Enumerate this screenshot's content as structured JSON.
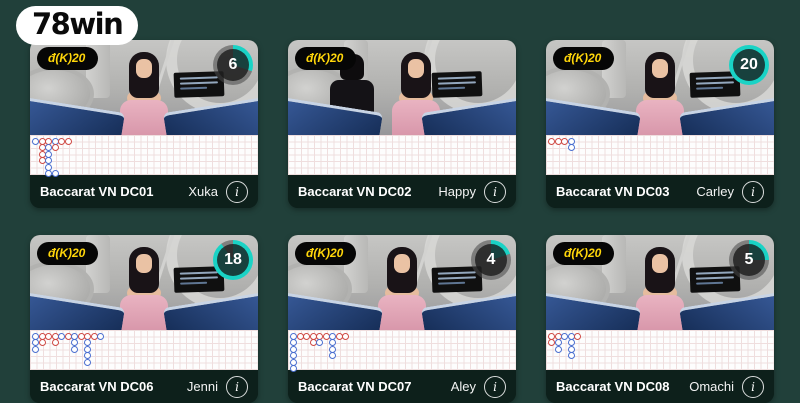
{
  "logo": {
    "text": "78win"
  },
  "icons": {
    "info": "i"
  },
  "colors": {
    "timer_arc": "#19d3c5",
    "timer_track": "rgba(72,72,72,0.55)",
    "road_red": "#cf4a45",
    "road_blue": "#4a6fd0",
    "badge_bg": "#060606",
    "badge_text": "#ffd60a",
    "page_bg": "#21403a"
  },
  "timer_max_seconds": 20,
  "cards": [
    {
      "title": "Baccarat VN DC01",
      "dealer": "Xuka",
      "min_bet": "đ(K)20",
      "has_timer": true,
      "timer": "6",
      "timer_pct": 30,
      "road": [
        [
          0,
          0,
          "B"
        ],
        [
          1,
          0,
          "R"
        ],
        [
          2,
          0,
          "R"
        ],
        [
          3,
          0,
          "B"
        ],
        [
          4,
          0,
          "R"
        ],
        [
          5,
          0,
          "R"
        ],
        [
          1,
          1,
          "R"
        ],
        [
          2,
          1,
          "B"
        ],
        [
          3,
          1,
          "R"
        ],
        [
          1,
          2,
          "R"
        ],
        [
          2,
          2,
          "B"
        ],
        [
          1,
          3,
          "R"
        ],
        [
          2,
          3,
          "B"
        ],
        [
          2,
          4,
          "B"
        ],
        [
          2,
          5,
          "B"
        ],
        [
          3,
          5,
          "B"
        ]
      ]
    },
    {
      "title": "Baccarat VN DC02",
      "dealer": "Happy",
      "min_bet": "đ(K)20",
      "has_timer": false,
      "timer": "",
      "timer_pct": 0,
      "road": []
    },
    {
      "title": "Baccarat VN DC03",
      "dealer": "Carley",
      "min_bet": "đ(K)20",
      "has_timer": true,
      "timer": "20",
      "timer_pct": 100,
      "road": [
        [
          0,
          0,
          "R"
        ],
        [
          1,
          0,
          "R"
        ],
        [
          2,
          0,
          "R"
        ],
        [
          3,
          0,
          "B"
        ],
        [
          3,
          1,
          "B"
        ]
      ]
    },
    {
      "title": "Baccarat VN DC06",
      "dealer": "Jenni",
      "min_bet": "đ(K)20",
      "has_timer": true,
      "timer": "18",
      "timer_pct": 90,
      "road": [
        [
          0,
          0,
          "B"
        ],
        [
          1,
          0,
          "R"
        ],
        [
          2,
          0,
          "R"
        ],
        [
          3,
          0,
          "R"
        ],
        [
          4,
          0,
          "B"
        ],
        [
          5,
          0,
          "R"
        ],
        [
          6,
          0,
          "B"
        ],
        [
          7,
          0,
          "R"
        ],
        [
          8,
          0,
          "R"
        ],
        [
          9,
          0,
          "R"
        ],
        [
          10,
          0,
          "B"
        ],
        [
          0,
          1,
          "B"
        ],
        [
          1,
          1,
          "R"
        ],
        [
          3,
          1,
          "R"
        ],
        [
          6,
          1,
          "B"
        ],
        [
          8,
          1,
          "B"
        ],
        [
          0,
          2,
          "B"
        ],
        [
          6,
          2,
          "B"
        ],
        [
          8,
          2,
          "B"
        ],
        [
          8,
          3,
          "B"
        ],
        [
          8,
          4,
          "B"
        ]
      ]
    },
    {
      "title": "Baccarat VN DC07",
      "dealer": "Aley",
      "min_bet": "đ(K)20",
      "has_timer": true,
      "timer": "4",
      "timer_pct": 20,
      "road": [
        [
          0,
          0,
          "B"
        ],
        [
          1,
          0,
          "R"
        ],
        [
          2,
          0,
          "R"
        ],
        [
          3,
          0,
          "R"
        ],
        [
          4,
          0,
          "R"
        ],
        [
          5,
          0,
          "R"
        ],
        [
          6,
          0,
          "B"
        ],
        [
          7,
          0,
          "R"
        ],
        [
          8,
          0,
          "R"
        ],
        [
          0,
          1,
          "B"
        ],
        [
          3,
          1,
          "R"
        ],
        [
          4,
          1,
          "B"
        ],
        [
          6,
          1,
          "B"
        ],
        [
          0,
          2,
          "B"
        ],
        [
          6,
          2,
          "B"
        ],
        [
          0,
          3,
          "B"
        ],
        [
          6,
          3,
          "B"
        ],
        [
          0,
          4,
          "B"
        ],
        [
          0,
          5,
          "B"
        ]
      ]
    },
    {
      "title": "Baccarat VN DC08",
      "dealer": "Omachi",
      "min_bet": "đ(K)20",
      "has_timer": true,
      "timer": "5",
      "timer_pct": 25,
      "road": [
        [
          0,
          0,
          "R"
        ],
        [
          1,
          0,
          "R"
        ],
        [
          2,
          0,
          "B"
        ],
        [
          3,
          0,
          "B"
        ],
        [
          4,
          0,
          "R"
        ],
        [
          0,
          1,
          "R"
        ],
        [
          1,
          1,
          "B"
        ],
        [
          3,
          1,
          "B"
        ],
        [
          1,
          2,
          "B"
        ],
        [
          3,
          2,
          "B"
        ],
        [
          3,
          3,
          "B"
        ]
      ]
    }
  ]
}
